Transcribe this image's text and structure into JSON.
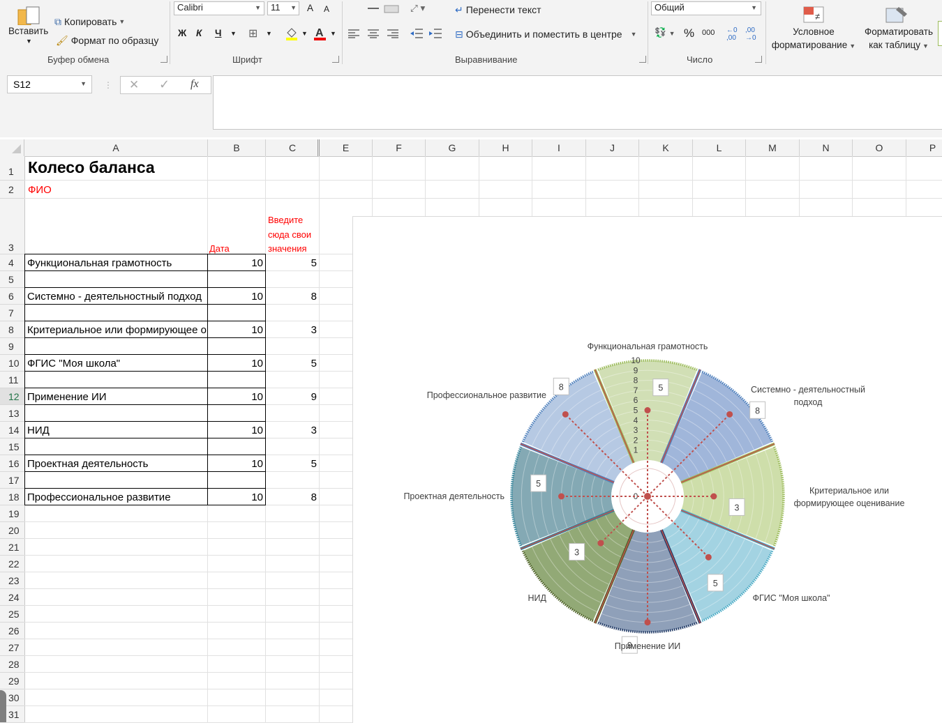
{
  "ribbon": {
    "paste_label": "Вставить",
    "copy_label": "Копировать",
    "format_painter_label": "Формат по образцу",
    "clipboard_group": "Буфер обмена",
    "font_name": "Calibri",
    "font_size": "11",
    "bold": "Ж",
    "italic": "К",
    "underline": "Ч",
    "font_group": "Шрифт",
    "wrap_text": "Перенести текст",
    "merge_center": "Объединить и поместить в центре",
    "alignment_group": "Выравнивание",
    "number_format": "Общий",
    "percent": "%",
    "thousands": "000",
    "number_group": "Число",
    "conditional_formatting": [
      "Условное",
      "форматирование"
    ],
    "format_as_table": [
      "Форматировать",
      "как таблицу"
    ]
  },
  "formula_bar": {
    "name_box": "S12",
    "fx": "fx",
    "value": ""
  },
  "columns": [
    "A",
    "B",
    "C",
    "E",
    "F",
    "G",
    "H",
    "I",
    "J",
    "K",
    "L",
    "M",
    "N",
    "O",
    "P"
  ],
  "rows": [
    "1",
    "2",
    "3",
    "4",
    "5",
    "6",
    "7",
    "8",
    "9",
    "10",
    "11",
    "12",
    "13",
    "14",
    "15",
    "16",
    "17",
    "18",
    "19",
    "20",
    "21",
    "22",
    "23",
    "24",
    "25",
    "26",
    "27",
    "28",
    "29",
    "30",
    "31"
  ],
  "sheet": {
    "title": "Колесо баланса",
    "fio": "ФИО",
    "date_header": "Дата",
    "input_header": [
      "Введите",
      "сюда свои",
      "значения"
    ],
    "items": [
      {
        "label": "Функциональная грамотность",
        "max": "10",
        "value": "5"
      },
      {
        "label": "Системно - деятельностный подход",
        "max": "10",
        "value": "8"
      },
      {
        "label": "Критериальное или формирующее оценивание",
        "max": "10",
        "value": "3"
      },
      {
        "label": "ФГИС \"Моя школа\"",
        "max": "10",
        "value": "5"
      },
      {
        "label": "Применение ИИ",
        "max": "10",
        "value": "9"
      },
      {
        "label": "НИД",
        "max": "10",
        "value": "3"
      },
      {
        "label": "Проектная деятельность",
        "max": "10",
        "value": "5"
      },
      {
        "label": "Профессиональное развитие",
        "max": "10",
        "value": "8"
      }
    ]
  },
  "chart_data": {
    "type": "radar",
    "categories": [
      "Функциональная грамотность",
      "Системно - деятельностный подход",
      "Критериальное или формирующее оценивание",
      "ФГИС \"Моя школа\"",
      "Применение ИИ",
      "НИД",
      "Проектная деятельность",
      "Профессиональное развитие"
    ],
    "category_label_lines": [
      [
        "Функциональная грамотность"
      ],
      [
        "Системно - деятельностный",
        "подход"
      ],
      [
        "Критериальное или",
        "формирующее оценивание"
      ],
      [
        "ФГИС \"Моя школа\""
      ],
      [
        "Применение ИИ"
      ],
      [
        "НИД"
      ],
      [
        "Проектная деятельность"
      ],
      [
        "Профессиональное развитие"
      ]
    ],
    "max_values": [
      10,
      10,
      10,
      10,
      10,
      10,
      10,
      10
    ],
    "values": [
      5,
      8,
      3,
      5,
      9,
      3,
      5,
      8
    ],
    "rlim": [
      0,
      10
    ],
    "ticks": [
      "0",
      "1",
      "2",
      "3",
      "4",
      "5",
      "6",
      "7",
      "8",
      "9",
      "10"
    ],
    "segment_colors": [
      "#c9d9a8",
      "#8fa9d4",
      "#c6d89b",
      "#93cbdd",
      "#7b8fad",
      "#7f9a5e",
      "#6e9aa7",
      "#a9bfde"
    ],
    "border_colors": [
      "#9bbb59",
      "#4f81bd",
      "#9bbb59",
      "#4bacc6",
      "#1f3864",
      "#4f6228",
      "#31849b",
      "#4f81bd"
    ],
    "value_color": "#c0504d"
  }
}
